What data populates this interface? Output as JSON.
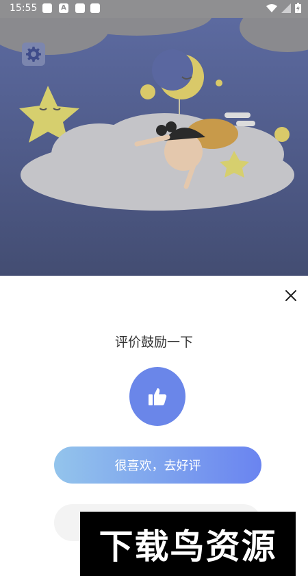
{
  "status_bar": {
    "time": "15:55"
  },
  "dialog": {
    "title": "评价鼓励一下",
    "like_button_label": "很喜欢，去好评"
  },
  "watermark": {
    "text": "下载鸟资源"
  },
  "colors": {
    "accent": "#6a86e9",
    "gradient_start": "#93c4ec",
    "gradient_end": "#6a84f0",
    "scene_bg": "#4b5681"
  },
  "icons": [
    "gear-icon",
    "close-icon",
    "thumbs-up-icon"
  ]
}
